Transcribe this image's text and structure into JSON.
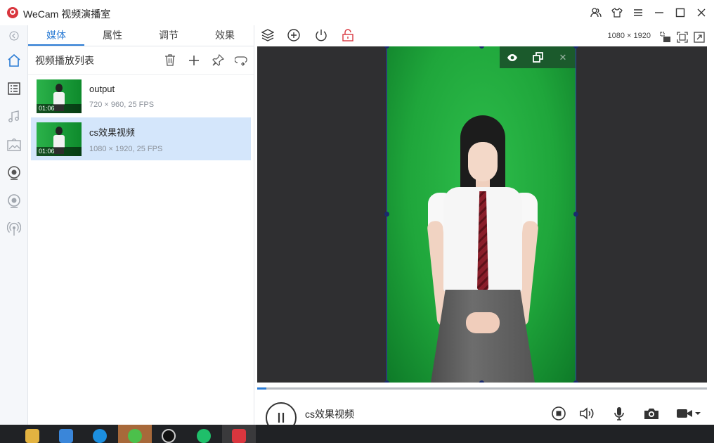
{
  "app": {
    "title": "WeCam 视频演播室"
  },
  "tabs": [
    {
      "label": "媒体",
      "active": true
    },
    {
      "label": "属性",
      "active": false
    },
    {
      "label": "调节",
      "active": false
    },
    {
      "label": "效果",
      "active": false
    }
  ],
  "media_list": {
    "title": "视频播放列表",
    "items": [
      {
        "name": "output",
        "meta": "720 × 960, 25 FPS",
        "duration": "01:06",
        "selected": false
      },
      {
        "name": "cs效果视频",
        "meta": "1080 × 1920, 25 FPS",
        "duration": "01:06",
        "selected": true
      }
    ]
  },
  "preview": {
    "resolution": "1080 × 1920"
  },
  "playback": {
    "now_playing": "cs效果视频",
    "progress_fraction": 0.02
  },
  "colors": {
    "accent": "#2a7bd4",
    "selected_row": "#d4e6fb",
    "green_screen": "#1fa63b",
    "lock_red": "#d9363e"
  },
  "icons": {
    "window": [
      "users-icon",
      "shirt-icon",
      "menu-icon",
      "minimize-icon",
      "maximize-icon",
      "close-icon"
    ],
    "rail": [
      "collapse-icon",
      "home-icon",
      "list-icon",
      "music-icon",
      "image-icon",
      "webcam-icon",
      "camera-icon",
      "broadcast-icon"
    ],
    "list_header": [
      "trash-icon",
      "plus-icon",
      "pin-icon",
      "loop-icon"
    ],
    "toolbar": [
      "layers-icon",
      "add-circle-icon",
      "power-icon",
      "unlock-icon",
      "layout-icon",
      "fit-icon",
      "expand-icon"
    ],
    "overlay": [
      "eye-icon",
      "restore-icon",
      "close-icon"
    ],
    "playback": [
      "pause-icon",
      "stop-icon",
      "volume-icon",
      "mic-icon",
      "snapshot-icon",
      "record-icon"
    ]
  }
}
